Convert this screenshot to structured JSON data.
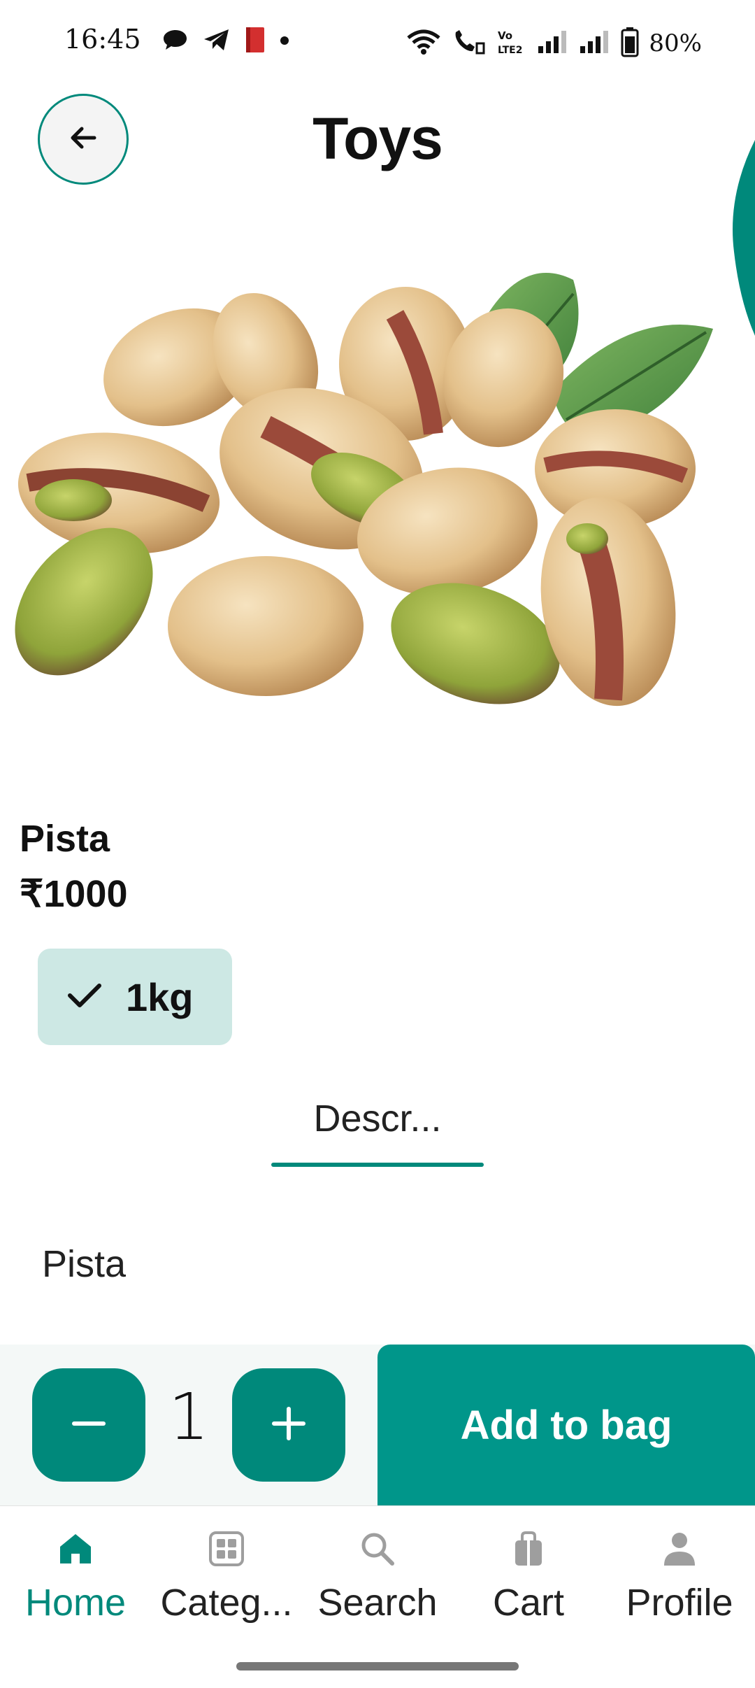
{
  "status_bar": {
    "time": "16:45",
    "battery": "80%",
    "notification_icons": [
      "chat-bubble-icon",
      "telegram-icon",
      "book-icon",
      "dot-icon"
    ],
    "system_icons": [
      "wifi-icon",
      "wifi-call-icon",
      "volte-icon",
      "signal-icon",
      "signal-icon",
      "battery-icon"
    ],
    "volte_text": "Vo LTE2"
  },
  "header": {
    "title": "Toys"
  },
  "product": {
    "name": "Pista",
    "price": "₹1000",
    "variant_selected": "1kg"
  },
  "tabs": {
    "description_label": "Descr...",
    "description_text": "Pista"
  },
  "cart_controls": {
    "quantity": "1",
    "add_label": "Add to bag"
  },
  "bottom_nav": {
    "items": [
      {
        "label": "Home",
        "icon": "home-icon",
        "active": true
      },
      {
        "label": "Categ...",
        "icon": "categories-icon",
        "active": false
      },
      {
        "label": "Search",
        "icon": "search-icon",
        "active": false
      },
      {
        "label": "Cart",
        "icon": "bag-icon",
        "active": false
      },
      {
        "label": "Profile",
        "icon": "profile-icon",
        "active": false
      }
    ]
  },
  "colors": {
    "accent": "#00897b",
    "accent_button": "#00968a",
    "chip_bg": "#cde8e4",
    "inactive_icon": "#9e9e9e"
  }
}
